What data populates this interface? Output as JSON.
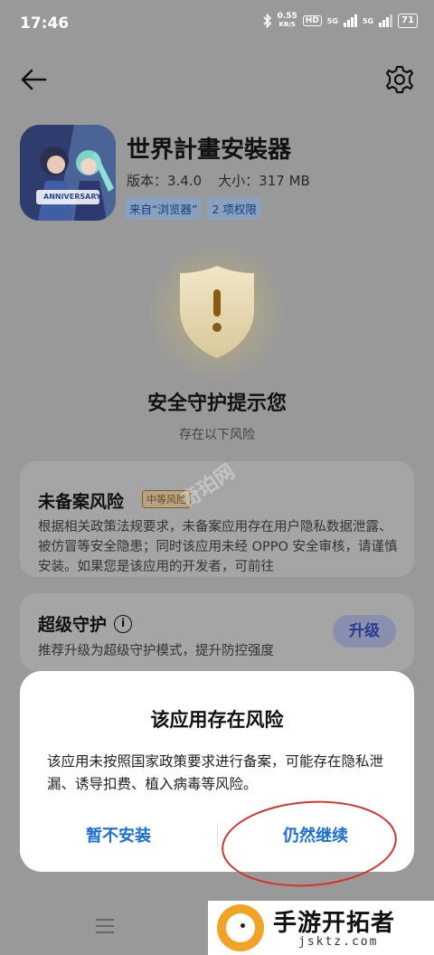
{
  "status_bar": {
    "time": "17:46",
    "net_speed_value": "0.55",
    "net_speed_unit": "KB/S",
    "hd_label": "HD",
    "sim1_label": "5G",
    "sim2_label": "5G",
    "battery": "71"
  },
  "app": {
    "name": "世界計畫安裝器",
    "icon_caption": "ANNIVERSARY",
    "version": "版本：3.4.0",
    "size": "大小：317 MB",
    "source_tag": "来自“浏览器”",
    "permission_tag": "2 项权限"
  },
  "protection": {
    "title": "安全守护提示您",
    "subtitle": "存在以下风险"
  },
  "risk_card": {
    "title": "未备案风险",
    "badge": "中等风险",
    "description": "根据相关政策法规要求，未备案应用存在用户隐私数据泄露、被仿冒等安全隐患；同时该应用未经 OPPO 安全审核，请谨慎安装。如果您是该应用的开发者，可前往"
  },
  "guard_card": {
    "title": "超级守护",
    "description": "推荐升级为超级守护模式，提升防控强度",
    "upgrade_label": "升级"
  },
  "dialog": {
    "title": "该应用存在风险",
    "body": "该应用未按照国家政策要求进行备案，可能存在隐私泄漏、诱导扣费、植入病毒等风险。",
    "cancel_label": "暂不安装",
    "continue_label": "仍然继续"
  },
  "watermark": {
    "site_name": "手游开拓者",
    "site_url": "jsktz.com",
    "overlay_text": "奇珀网"
  },
  "colors": {
    "accent_blue": "#1b6fd6",
    "annotation_red": "#d6322b",
    "banner_orange": "#f1a325"
  },
  "icons": [
    "back-arrow-icon",
    "gear-icon",
    "shield-warning-icon",
    "info-icon",
    "menu-icon",
    "signal-icon",
    "battery-icon",
    "bluetooth-icon"
  ]
}
